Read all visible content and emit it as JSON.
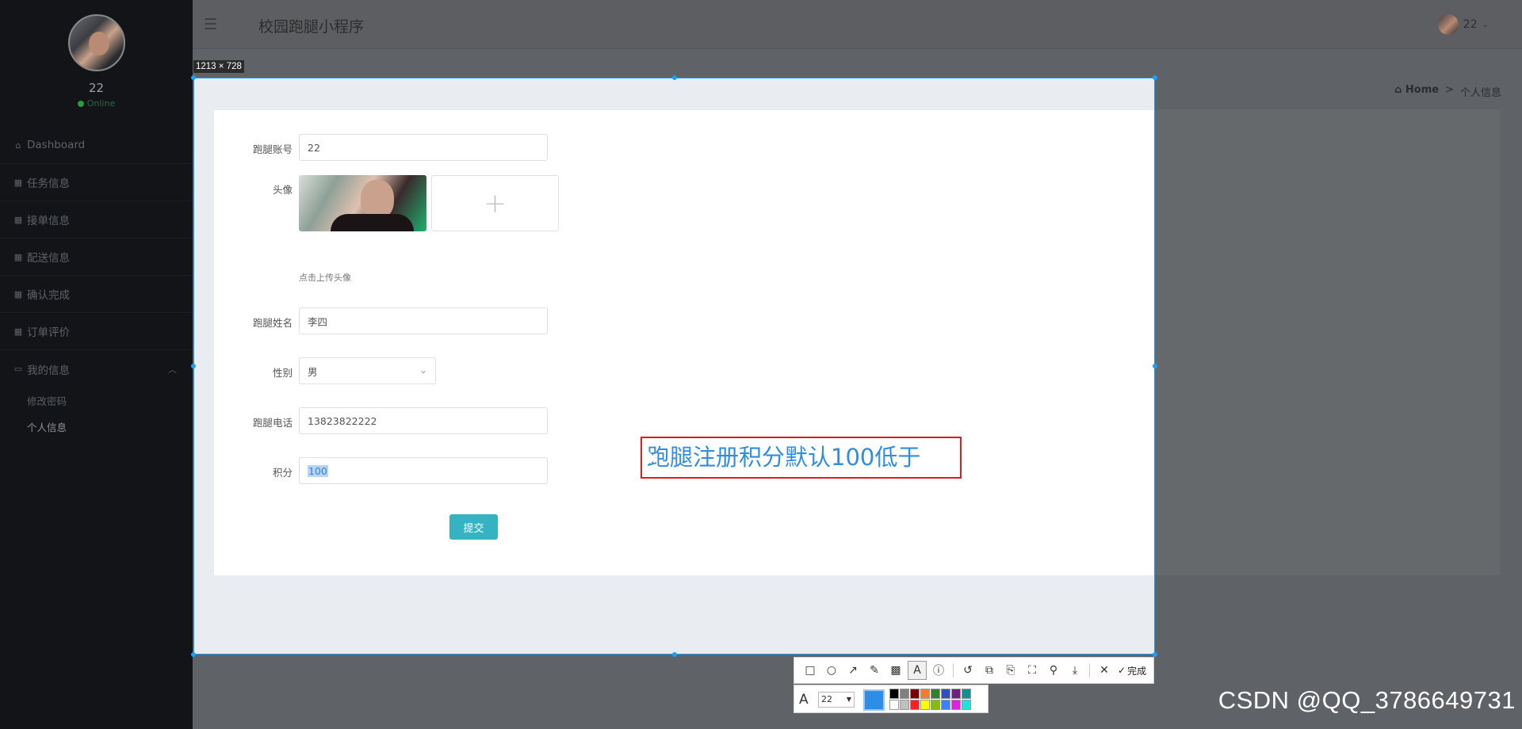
{
  "sidebar": {
    "user_name": "22",
    "status": "Online",
    "nav": [
      {
        "label": "Dashboard",
        "icon": "⌂"
      },
      {
        "label": "任务信息",
        "icon": "▦"
      },
      {
        "label": "接单信息",
        "icon": "▦"
      },
      {
        "label": "配送信息",
        "icon": "▦"
      },
      {
        "label": "确认完成",
        "icon": "▦"
      },
      {
        "label": "订单评价",
        "icon": "▦"
      },
      {
        "label": "我的信息",
        "icon": "▭"
      }
    ],
    "sub_items": [
      "修改密码",
      "个人信息"
    ]
  },
  "header": {
    "title": "校园跑腿小程序",
    "user": "22"
  },
  "breadcrumb": {
    "home": "Home",
    "separator": ">",
    "current": "个人信息"
  },
  "capture": {
    "size_label": "1213 × 728"
  },
  "form": {
    "account_label": "跑腿账号",
    "account_value": "22",
    "avatar_label": "头像",
    "upload_plus": "+",
    "upload_hint": "点击上传头像",
    "name_label": "跑腿姓名",
    "name_value": "李四",
    "gender_label": "性别",
    "gender_value": "男",
    "phone_label": "跑腿电话",
    "phone_value": "13823822222",
    "points_label": "积分",
    "points_value": "100",
    "submit_label": "提交"
  },
  "annotation": {
    "text": "跑腿注册积分默认100低于",
    "border_color": "#e01c1c",
    "text_color": "#2f8de4"
  },
  "toolbar": {
    "done_label": "完成",
    "font_size": "22",
    "current_color": "#2e8de6",
    "palette": [
      "#000000",
      "#808080",
      "#800000",
      "#f08030",
      "#308030",
      "#3050c0",
      "#702080",
      "#109090",
      "#ffffff",
      "#c0c0c0",
      "#ff2020",
      "#ffff00",
      "#80c000",
      "#4080ff",
      "#e020e0",
      "#20e0e0"
    ]
  },
  "watermark": "CSDN @QQ_3786649731"
}
